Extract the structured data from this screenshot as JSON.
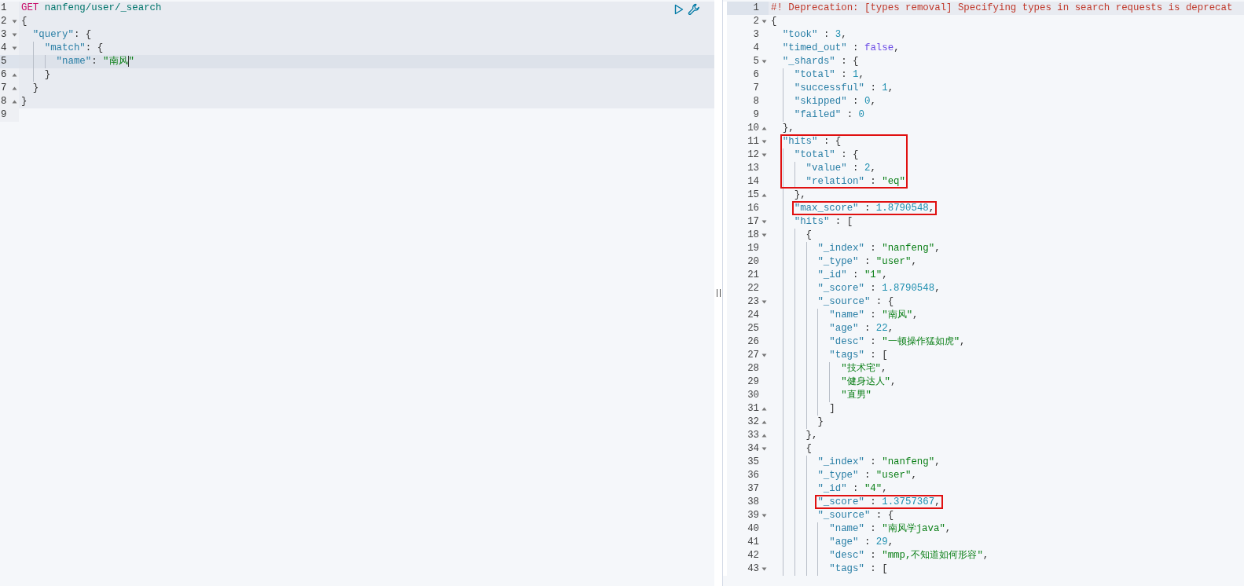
{
  "request": {
    "lines": [
      {
        "number": "1",
        "in_request": true,
        "active": false,
        "tokens": [
          {
            "kind": "method",
            "text": "GET"
          },
          {
            "kind": "url",
            "text": " nanfeng/user/_search"
          }
        ]
      },
      {
        "number": "2",
        "expanded": true,
        "in_request": true,
        "active": false,
        "tokens": [
          {
            "kind": "punct",
            "text": "{"
          }
        ]
      },
      {
        "number": "3",
        "expanded": true,
        "in_request": true,
        "active": false,
        "tokens": [
          {
            "kind": "key",
            "text": "  \"query\""
          },
          {
            "kind": "punct",
            "text": ": {"
          }
        ]
      },
      {
        "number": "4",
        "expanded": true,
        "in_request": true,
        "active": false,
        "tokens": [
          {
            "kind": "key",
            "text": "    \"match\""
          },
          {
            "kind": "punct",
            "text": ": {"
          }
        ]
      },
      {
        "number": "5",
        "in_request": true,
        "active": true,
        "tokens": [
          {
            "kind": "key",
            "text": "      \"name\""
          },
          {
            "kind": "punct",
            "text": ": "
          },
          {
            "kind": "str",
            "text": "\"南风"
          },
          {
            "kind": "cursor"
          },
          {
            "kind": "str",
            "text": "\""
          }
        ]
      },
      {
        "number": "6",
        "fold_end": true,
        "in_request": true,
        "active": false,
        "tokens": [
          {
            "kind": "punct",
            "text": "    }"
          }
        ]
      },
      {
        "number": "7",
        "fold_end": true,
        "in_request": true,
        "active": false,
        "tokens": [
          {
            "kind": "punct",
            "text": "  }"
          }
        ]
      },
      {
        "number": "8",
        "fold_end": true,
        "in_request": true,
        "active": false,
        "tokens": [
          {
            "kind": "punct",
            "text": "}"
          }
        ]
      },
      {
        "number": "9",
        "in_request": false,
        "active": false
      }
    ]
  },
  "response": {
    "lines": [
      {
        "number": "1",
        "active": true,
        "tokens": [
          {
            "kind": "comment",
            "text": "#! Deprecation: [types removal] Specifying types in search requests is deprecat"
          }
        ]
      },
      {
        "number": "2",
        "expanded": true,
        "active": false,
        "tokens": [
          {
            "kind": "punct",
            "text": "{"
          }
        ]
      },
      {
        "number": "3",
        "active": false,
        "tokens": [
          {
            "kind": "key",
            "text": "  \"took\""
          },
          {
            "kind": "punct",
            "text": " : "
          },
          {
            "kind": "num",
            "text": "3"
          },
          {
            "kind": "punct",
            "text": ","
          }
        ]
      },
      {
        "number": "4",
        "active": false,
        "tokens": [
          {
            "kind": "key",
            "text": "  \"timed_out\""
          },
          {
            "kind": "punct",
            "text": " : "
          },
          {
            "kind": "bool",
            "text": "false"
          },
          {
            "kind": "punct",
            "text": ","
          }
        ]
      },
      {
        "number": "5",
        "expanded": true,
        "active": false,
        "tokens": [
          {
            "kind": "key",
            "text": "  \"_shards\""
          },
          {
            "kind": "punct",
            "text": " : {"
          }
        ]
      },
      {
        "number": "6",
        "active": false,
        "tokens": [
          {
            "kind": "key",
            "text": "    \"total\""
          },
          {
            "kind": "punct",
            "text": " : "
          },
          {
            "kind": "num",
            "text": "1"
          },
          {
            "kind": "punct",
            "text": ","
          }
        ]
      },
      {
        "number": "7",
        "active": false,
        "tokens": [
          {
            "kind": "key",
            "text": "    \"successful\""
          },
          {
            "kind": "punct",
            "text": " : "
          },
          {
            "kind": "num",
            "text": "1"
          },
          {
            "kind": "punct",
            "text": ","
          }
        ]
      },
      {
        "number": "8",
        "active": false,
        "tokens": [
          {
            "kind": "key",
            "text": "    \"skipped\""
          },
          {
            "kind": "punct",
            "text": " : "
          },
          {
            "kind": "num",
            "text": "0"
          },
          {
            "kind": "punct",
            "text": ","
          }
        ]
      },
      {
        "number": "9",
        "active": false,
        "tokens": [
          {
            "kind": "key",
            "text": "    \"failed\""
          },
          {
            "kind": "punct",
            "text": " : "
          },
          {
            "kind": "num",
            "text": "0"
          }
        ]
      },
      {
        "number": "10",
        "fold_end": true,
        "active": false,
        "tokens": [
          {
            "kind": "punct",
            "text": "  },"
          }
        ]
      },
      {
        "number": "11",
        "expanded": true,
        "active": false,
        "boxed": true,
        "tokens": [
          {
            "kind": "key",
            "text": "  \"hits\""
          },
          {
            "kind": "punct",
            "text": " : {"
          }
        ]
      },
      {
        "number": "12",
        "expanded": true,
        "active": false,
        "boxed": true,
        "tokens": [
          {
            "kind": "key",
            "text": "    \"total\""
          },
          {
            "kind": "punct",
            "text": " : {"
          }
        ]
      },
      {
        "number": "13",
        "active": false,
        "boxed": true,
        "tokens": [
          {
            "kind": "key",
            "text": "      \"value\""
          },
          {
            "kind": "punct",
            "text": " : "
          },
          {
            "kind": "num",
            "text": "2"
          },
          {
            "kind": "punct",
            "text": ","
          }
        ]
      },
      {
        "number": "14",
        "active": false,
        "boxed": true,
        "tokens": [
          {
            "kind": "key",
            "text": "      \"relation\""
          },
          {
            "kind": "punct",
            "text": " : "
          },
          {
            "kind": "str",
            "text": "\"eq\""
          }
        ]
      },
      {
        "number": "15",
        "fold_end": true,
        "active": false,
        "tokens": [
          {
            "kind": "punct",
            "text": "    },"
          }
        ]
      },
      {
        "number": "16",
        "active": false,
        "boxed": true,
        "tokens": [
          {
            "kind": "key",
            "text": "    \"max_score\""
          },
          {
            "kind": "punct",
            "text": " : "
          },
          {
            "kind": "num",
            "text": "1.8790548"
          },
          {
            "kind": "punct",
            "text": ","
          }
        ]
      },
      {
        "number": "17",
        "expanded": true,
        "active": false,
        "tokens": [
          {
            "kind": "key",
            "text": "    \"hits\""
          },
          {
            "kind": "punct",
            "text": " : ["
          }
        ]
      },
      {
        "number": "18",
        "expanded": true,
        "active": false,
        "tokens": [
          {
            "kind": "punct",
            "text": "      {"
          }
        ]
      },
      {
        "number": "19",
        "active": false,
        "tokens": [
          {
            "kind": "key",
            "text": "        \"_index\""
          },
          {
            "kind": "punct",
            "text": " : "
          },
          {
            "kind": "str",
            "text": "\"nanfeng\""
          },
          {
            "kind": "punct",
            "text": ","
          }
        ]
      },
      {
        "number": "20",
        "active": false,
        "tokens": [
          {
            "kind": "key",
            "text": "        \"_type\""
          },
          {
            "kind": "punct",
            "text": " : "
          },
          {
            "kind": "str",
            "text": "\"user\""
          },
          {
            "kind": "punct",
            "text": ","
          }
        ]
      },
      {
        "number": "21",
        "active": false,
        "tokens": [
          {
            "kind": "key",
            "text": "        \"_id\""
          },
          {
            "kind": "punct",
            "text": " : "
          },
          {
            "kind": "str",
            "text": "\"1\""
          },
          {
            "kind": "punct",
            "text": ","
          }
        ]
      },
      {
        "number": "22",
        "active": false,
        "tokens": [
          {
            "kind": "key",
            "text": "        \"_score\""
          },
          {
            "kind": "punct",
            "text": " : "
          },
          {
            "kind": "num",
            "text": "1.8790548"
          },
          {
            "kind": "punct",
            "text": ","
          }
        ]
      },
      {
        "number": "23",
        "expanded": true,
        "active": false,
        "tokens": [
          {
            "kind": "key",
            "text": "        \"_source\""
          },
          {
            "kind": "punct",
            "text": " : {"
          }
        ]
      },
      {
        "number": "24",
        "active": false,
        "tokens": [
          {
            "kind": "key",
            "text": "          \"name\""
          },
          {
            "kind": "punct",
            "text": " : "
          },
          {
            "kind": "str",
            "text": "\"南风\""
          },
          {
            "kind": "punct",
            "text": ","
          }
        ]
      },
      {
        "number": "25",
        "active": false,
        "tokens": [
          {
            "kind": "key",
            "text": "          \"age\""
          },
          {
            "kind": "punct",
            "text": " : "
          },
          {
            "kind": "num",
            "text": "22"
          },
          {
            "kind": "punct",
            "text": ","
          }
        ]
      },
      {
        "number": "26",
        "active": false,
        "tokens": [
          {
            "kind": "key",
            "text": "          \"desc\""
          },
          {
            "kind": "punct",
            "text": " : "
          },
          {
            "kind": "str",
            "text": "\"一顿操作猛如虎\""
          },
          {
            "kind": "punct",
            "text": ","
          }
        ]
      },
      {
        "number": "27",
        "expanded": true,
        "active": false,
        "tokens": [
          {
            "kind": "key",
            "text": "          \"tags\""
          },
          {
            "kind": "punct",
            "text": " : ["
          }
        ]
      },
      {
        "number": "28",
        "active": false,
        "tokens": [
          {
            "kind": "str",
            "text": "            \"技术宅\""
          },
          {
            "kind": "punct",
            "text": ","
          }
        ]
      },
      {
        "number": "29",
        "active": false,
        "tokens": [
          {
            "kind": "str",
            "text": "            \"健身达人\""
          },
          {
            "kind": "punct",
            "text": ","
          }
        ]
      },
      {
        "number": "30",
        "active": false,
        "tokens": [
          {
            "kind": "str",
            "text": "            \"直男\""
          }
        ]
      },
      {
        "number": "31",
        "fold_end": true,
        "active": false,
        "tokens": [
          {
            "kind": "punct",
            "text": "          ]"
          }
        ]
      },
      {
        "number": "32",
        "fold_end": true,
        "active": false,
        "tokens": [
          {
            "kind": "punct",
            "text": "        }"
          }
        ]
      },
      {
        "number": "33",
        "fold_end": true,
        "active": false,
        "tokens": [
          {
            "kind": "punct",
            "text": "      },"
          }
        ]
      },
      {
        "number": "34",
        "expanded": true,
        "active": false,
        "tokens": [
          {
            "kind": "punct",
            "text": "      {"
          }
        ]
      },
      {
        "number": "35",
        "active": false,
        "tokens": [
          {
            "kind": "key",
            "text": "        \"_index\""
          },
          {
            "kind": "punct",
            "text": " : "
          },
          {
            "kind": "str",
            "text": "\"nanfeng\""
          },
          {
            "kind": "punct",
            "text": ","
          }
        ]
      },
      {
        "number": "36",
        "active": false,
        "tokens": [
          {
            "kind": "key",
            "text": "        \"_type\""
          },
          {
            "kind": "punct",
            "text": " : "
          },
          {
            "kind": "str",
            "text": "\"user\""
          },
          {
            "kind": "punct",
            "text": ","
          }
        ]
      },
      {
        "number": "37",
        "active": false,
        "tokens": [
          {
            "kind": "key",
            "text": "        \"_id\""
          },
          {
            "kind": "punct",
            "text": " : "
          },
          {
            "kind": "str",
            "text": "\"4\""
          },
          {
            "kind": "punct",
            "text": ","
          }
        ]
      },
      {
        "number": "38",
        "active": false,
        "boxed": true,
        "tokens": [
          {
            "kind": "key",
            "text": "        \"_score\""
          },
          {
            "kind": "punct",
            "text": " : "
          },
          {
            "kind": "num",
            "text": "1.3757367"
          },
          {
            "kind": "punct",
            "text": ","
          }
        ]
      },
      {
        "number": "39",
        "expanded": true,
        "active": false,
        "tokens": [
          {
            "kind": "key",
            "text": "        \"_source\""
          },
          {
            "kind": "punct",
            "text": " : {"
          }
        ]
      },
      {
        "number": "40",
        "active": false,
        "tokens": [
          {
            "kind": "key",
            "text": "          \"name\""
          },
          {
            "kind": "punct",
            "text": " : "
          },
          {
            "kind": "str",
            "text": "\"南风学java\""
          },
          {
            "kind": "punct",
            "text": ","
          }
        ]
      },
      {
        "number": "41",
        "active": false,
        "tokens": [
          {
            "kind": "key",
            "text": "          \"age\""
          },
          {
            "kind": "punct",
            "text": " : "
          },
          {
            "kind": "num",
            "text": "29"
          },
          {
            "kind": "punct",
            "text": ","
          }
        ]
      },
      {
        "number": "42",
        "active": false,
        "tokens": [
          {
            "kind": "key",
            "text": "          \"desc\""
          },
          {
            "kind": "punct",
            "text": " : "
          },
          {
            "kind": "str",
            "text": "\"mmp,不知道如何形容\""
          },
          {
            "kind": "punct",
            "text": ","
          }
        ]
      },
      {
        "number": "43",
        "expanded": true,
        "active": false,
        "tokens": [
          {
            "kind": "key",
            "text": "          \"tags\""
          },
          {
            "kind": "punct",
            "text": " : ["
          }
        ]
      }
    ]
  }
}
